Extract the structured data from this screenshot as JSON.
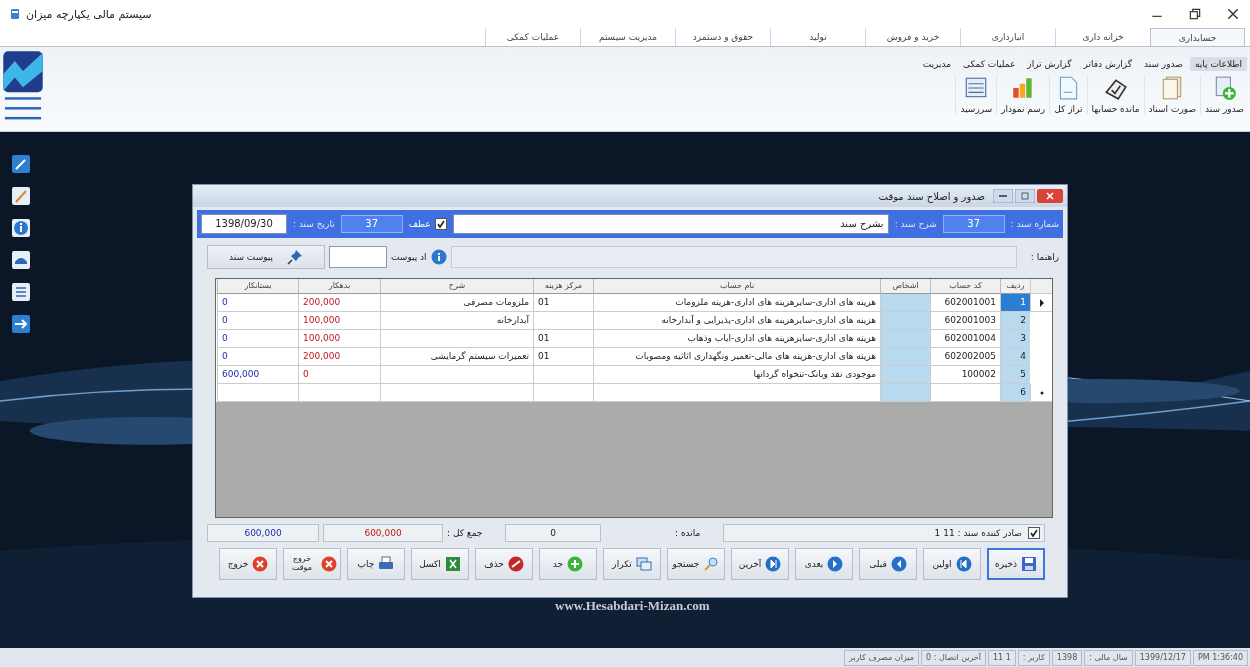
{
  "window": {
    "title": "سیستم مالی یکپارچه میزان"
  },
  "tabs": [
    {
      "label": "حسابداری",
      "selected": true
    },
    {
      "label": "خزانه داری",
      "selected": false
    },
    {
      "label": "انبارداری",
      "selected": false
    },
    {
      "label": "خرید و فروش",
      "selected": false
    },
    {
      "label": "تولید",
      "selected": false
    },
    {
      "label": "حقوق و دستمزد",
      "selected": false
    },
    {
      "label": "مدیریت سیستم",
      "selected": false
    },
    {
      "label": "عملیات کمکی",
      "selected": false
    }
  ],
  "subtabs": [
    {
      "label": "اطلاعات پایه",
      "selected": true
    },
    {
      "label": "صدور سند",
      "selected": false
    },
    {
      "label": "گزارش دفاتر",
      "selected": false
    },
    {
      "label": "گزارش تراز",
      "selected": false
    },
    {
      "label": "عملیات کمکی",
      "selected": false
    },
    {
      "label": "مدیریت",
      "selected": false
    }
  ],
  "ribbon_buttons": [
    {
      "label": "صدور سند",
      "kind": "new_doc"
    },
    {
      "label": "صورت اسناد",
      "kind": "docs"
    },
    {
      "label": "مانده حسابها",
      "kind": "clipboard"
    },
    {
      "label": "تراز کل",
      "kind": "page"
    },
    {
      "label": "رسم نمودار",
      "kind": "chart"
    },
    {
      "label": "سررسید",
      "kind": "notebook"
    }
  ],
  "dialog": {
    "title": "صدور و اصلاح سند موقت",
    "header": {
      "number_label": "شماره سند :",
      "number": "37",
      "description_label": "شرح سند :",
      "description": "بشرح سند",
      "ref_label": "عطف",
      "ref_checked": true,
      "ref_number": "37",
      "date_label": "تاریخ سند :",
      "date": "1398/09/30"
    },
    "guide_label": "راهنما :",
    "attach_count_label": "اد پیوست",
    "attach_button": "پیوست سند",
    "columns": [
      {
        "label": "ردیف",
        "kind": "row_no"
      },
      {
        "label": "کد حساب",
        "kind": "code"
      },
      {
        "label": "اشخاص",
        "kind": "person"
      },
      {
        "label": "نام حساب",
        "kind": "name"
      },
      {
        "label": "مرکز هزینه",
        "kind": "center"
      },
      {
        "label": "شرح",
        "kind": "desc"
      },
      {
        "label": "بدهکار",
        "kind": "debit"
      },
      {
        "label": "بستانکار",
        "kind": "credit"
      }
    ],
    "rows": [
      {
        "kind": "current",
        "selected": true,
        "cells": [
          "1",
          "602001001",
          "",
          "هزینه های اداری-سایرهزینه های اداری-هزینه ملزومات",
          "01",
          "ملزومات مصرفی",
          "200,000",
          "0"
        ]
      },
      {
        "kind": "normal",
        "selected": false,
        "cells": [
          "2",
          "602001003",
          "",
          "هزینه های اداری-سایرهزینه های اداری-پذیرایی و آبدارخانه",
          "",
          "آبدارخانه",
          "100,000",
          "0"
        ]
      },
      {
        "kind": "normal",
        "selected": false,
        "cells": [
          "3",
          "602001004",
          "",
          "هزینه های اداری-سایرهزینه های اداری-ایاب وذهاب",
          "01",
          "",
          "100,000",
          "0"
        ]
      },
      {
        "kind": "normal",
        "selected": false,
        "cells": [
          "4",
          "602002005",
          "",
          "هزینه های اداری-هزینه های مالی-تعمیر ونگهداری اثاثیه ومصوبات",
          "01",
          "تعمیرات سیستم گرمایشی",
          "200,000",
          "0"
        ]
      },
      {
        "kind": "normal",
        "selected": false,
        "cells": [
          "5",
          "100002",
          "",
          "موجودی نقد وبانک-تنخواه گردانها",
          "",
          "",
          "0",
          "600,000"
        ]
      },
      {
        "kind": "new",
        "selected": false,
        "cells": [
          "6",
          "",
          "",
          "",
          "",
          "",
          "",
          ""
        ]
      }
    ],
    "issuer_checked": true,
    "issuer": "صادر کننده سند : 11 1",
    "balance_label": "مانده :",
    "balance": "0",
    "total_label": "جمع کل :",
    "total_debit": "600,000",
    "total_credit": "600,000",
    "buttons": [
      {
        "label": "ذخیره",
        "kind": "save"
      },
      {
        "label": "اولین",
        "kind": "first"
      },
      {
        "label": "قبلی",
        "kind": "prev"
      },
      {
        "label": "بعدی",
        "kind": "next"
      },
      {
        "label": "آخرین",
        "kind": "last"
      },
      {
        "label": "جستجو",
        "kind": "search"
      },
      {
        "label": "تکرار",
        "kind": "repeat"
      },
      {
        "label": "جد",
        "kind": "add"
      },
      {
        "label": "حذف",
        "kind": "delete"
      },
      {
        "label": "اکسل",
        "kind": "excel"
      },
      {
        "label": "چاپ",
        "kind": "print"
      },
      {
        "label": "خروج موقت",
        "kind": "temp_exit"
      },
      {
        "label": "خروج",
        "kind": "exit"
      }
    ]
  },
  "desktop_text": "www.Hesabdari-Mizan.com",
  "status_bar": [
    "PM 1:36:40",
    "1399/12/17",
    "سال مالی :",
    "1398",
    "کاربر :",
    "1 11",
    "آخرین اتصال : 0",
    "میزان مصرف کاربر"
  ]
}
